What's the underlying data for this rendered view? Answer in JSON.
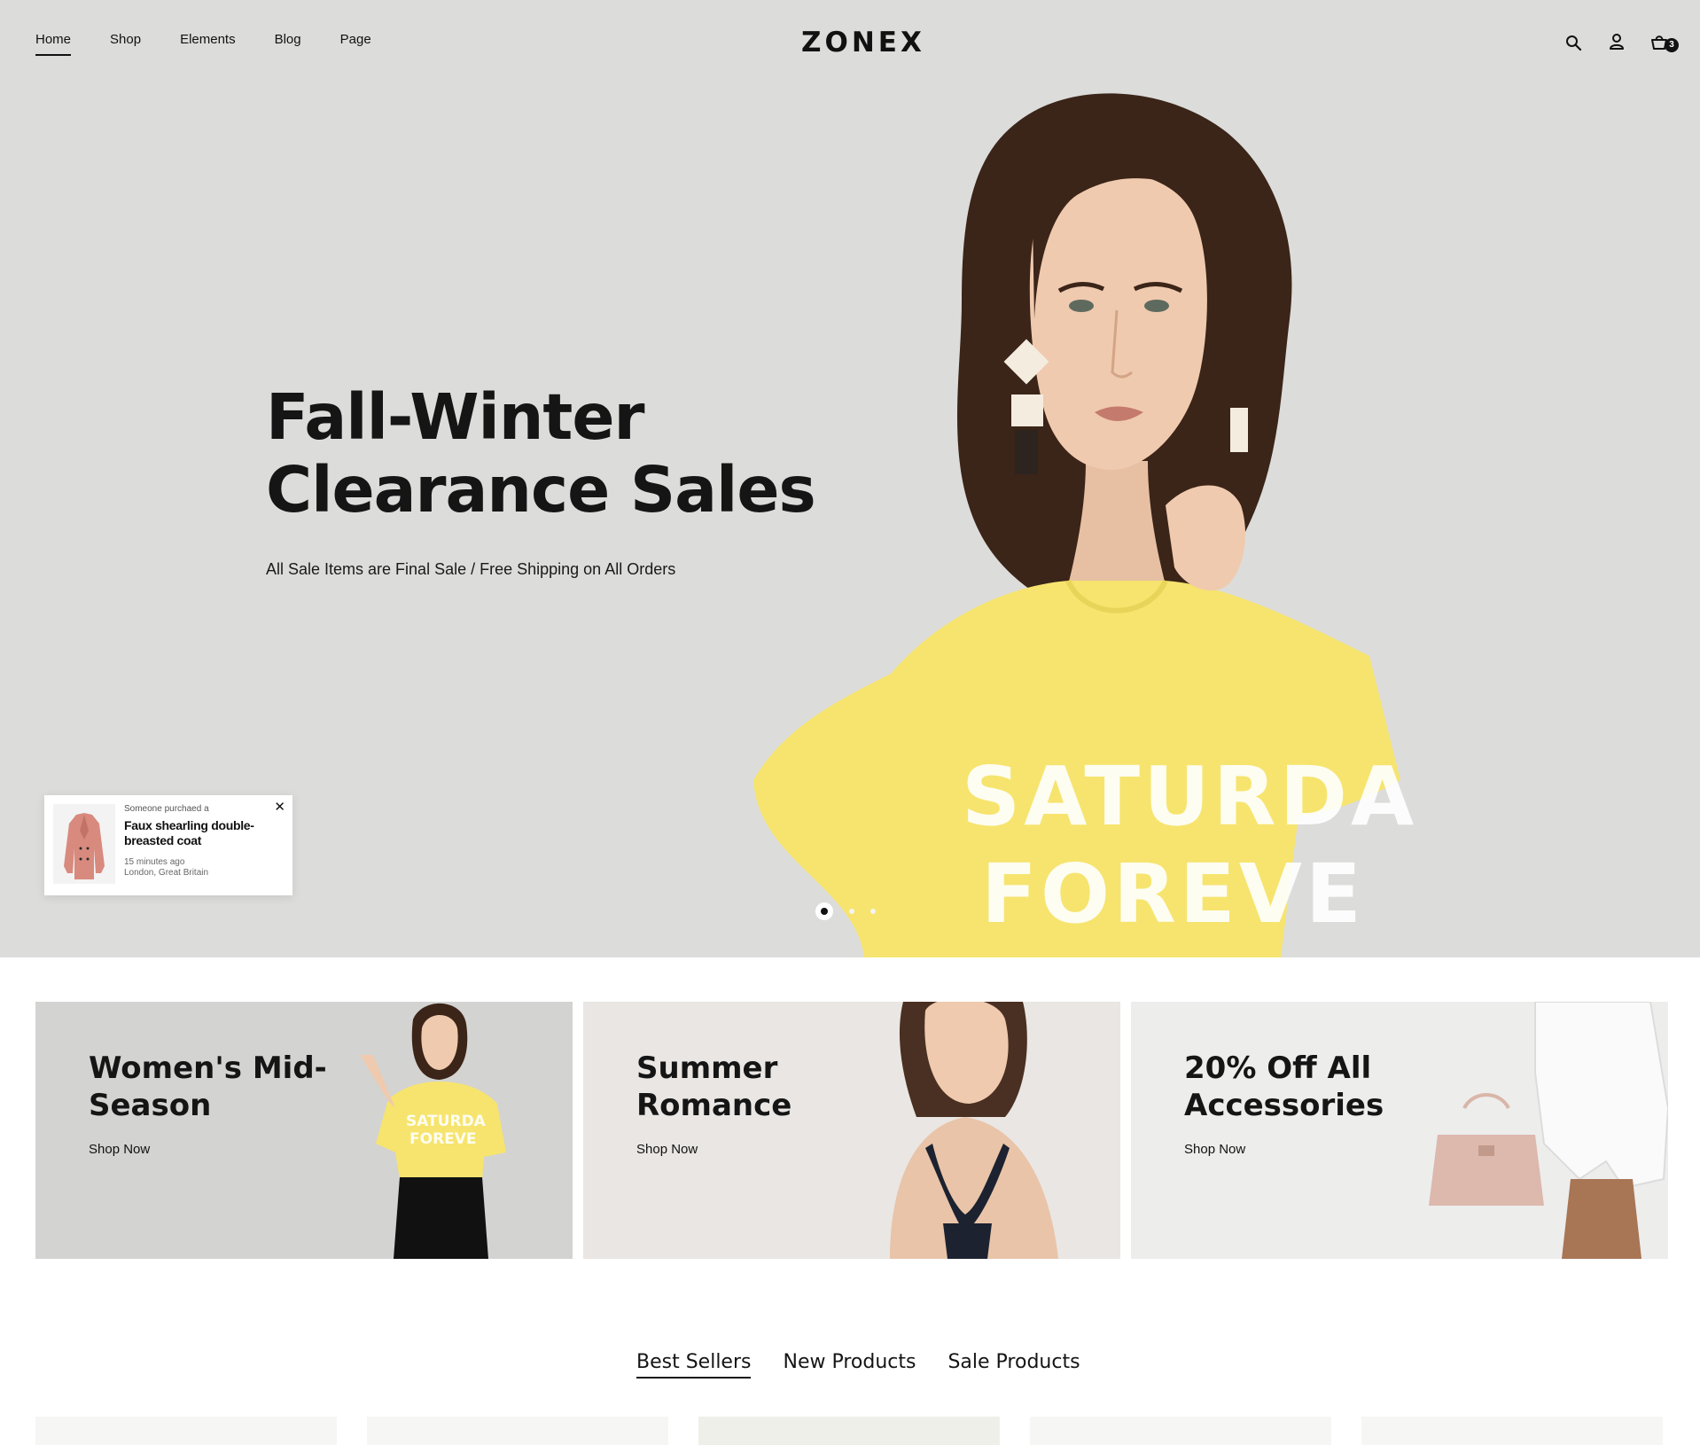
{
  "header": {
    "nav": [
      {
        "label": "Home",
        "active": true
      },
      {
        "label": "Shop",
        "active": false
      },
      {
        "label": "Elements",
        "active": false
      },
      {
        "label": "Blog",
        "active": false
      },
      {
        "label": "Page",
        "active": false
      }
    ],
    "logo": "ZONEX",
    "icons": [
      "search-icon",
      "user-icon",
      "cart-icon"
    ],
    "cart_count": "3"
  },
  "hero": {
    "title_line1": "Fall-Winter",
    "title_line2": "Clearance Sales",
    "subtitle": "All Sale Items are Final Sale / Free Shipping on All Orders",
    "shirt_text_1": "SATURDA",
    "shirt_text_2": "FOREVE",
    "slides": 3,
    "active_slide": 1,
    "background_color": "#dcdcda",
    "shirt_color": "#f6e46e"
  },
  "popup": {
    "pretext": "Someone purchaed a",
    "product": "Faux shearling double-breasted coat",
    "time": "15 minutes ago",
    "location": "London, Great Britain",
    "close_icon": "close-icon"
  },
  "banners": [
    {
      "title": "Women's Mid-Season",
      "link": "Shop Now",
      "bg": "#d3d3d2"
    },
    {
      "title": "Summer Romance",
      "link": "Shop Now",
      "bg": "#e9e6e3"
    },
    {
      "title": "20% Off All Accessories",
      "link": "Shop Now",
      "bg": "#ededec"
    }
  ],
  "product_tabs": [
    {
      "label": "Best Sellers",
      "active": true
    },
    {
      "label": "New Products",
      "active": false
    },
    {
      "label": "Sale Products",
      "active": false
    }
  ]
}
